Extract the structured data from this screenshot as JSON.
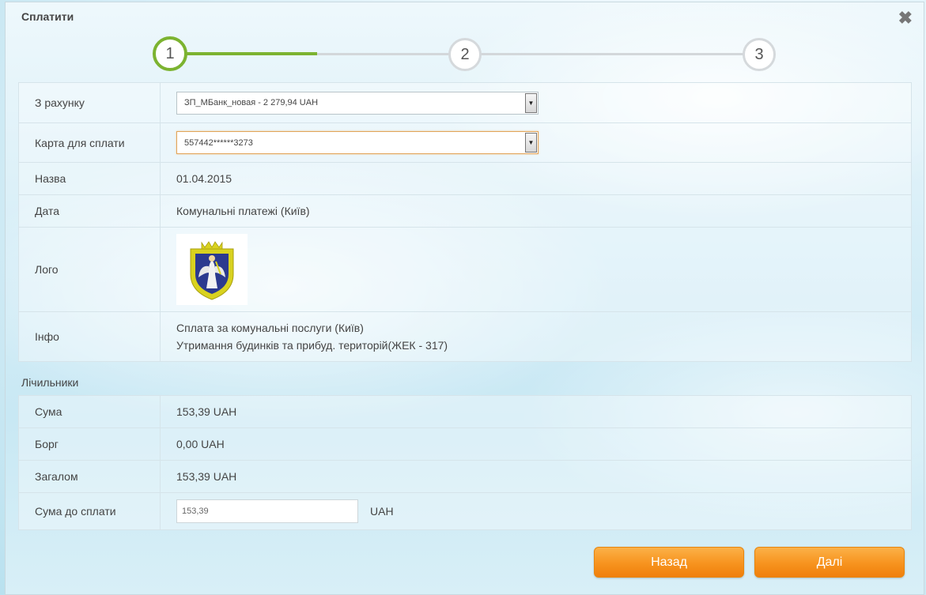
{
  "dialog": {
    "title": "Сплатити",
    "close_label": "✖"
  },
  "steps": [
    "1",
    "2",
    "3"
  ],
  "colors": {
    "accent": "#7cb330",
    "button": "#f7931e"
  },
  "form": {
    "account_label": "З рахунку",
    "account_value": "ЗП_МБанк_новая - 2 279,94 UAH",
    "card_label": "Карта для сплати",
    "card_value": "557442******3273",
    "name_label": "Назва",
    "name_value": "01.04.2015",
    "date_label": "Дата",
    "date_value": "Комунальні платежі (Київ)",
    "logo_label": "Лого",
    "info_label": "Інфо",
    "info_line1": "Сплата за комунальні послуги (Київ)",
    "info_line2": "Утримання будинків та прибуд. територій(ЖЕК - 317)"
  },
  "meters": {
    "section_title": "Лічильники",
    "sum_label": "Сума",
    "sum_value": "153,39 UAH",
    "debt_label": "Борг",
    "debt_value": "0,00 UAH",
    "total_label": "Загалом",
    "total_value": "153,39 UAH",
    "pay_label": "Сума до сплати",
    "pay_value": "153,39",
    "pay_currency": "UAH"
  },
  "buttons": {
    "back": "Назад",
    "next": "Далі"
  }
}
